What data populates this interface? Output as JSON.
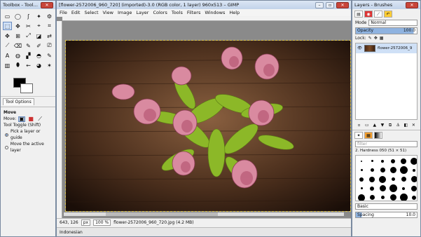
{
  "toolbox": {
    "title": "Toolbox - Tool Options",
    "tools": [
      "▭",
      "◯",
      "ʃ",
      "✦",
      "⚙",
      "⬚",
      "✥",
      "✂",
      "⌖",
      "⌗",
      "✥",
      "⊞",
      "⤢",
      "◪",
      "⇄",
      "⟋",
      "⌫",
      "✎",
      "✐",
      "⎚",
      "A",
      "◍",
      "▞",
      "◓",
      "✎",
      "▥",
      "⬮",
      "⇜",
      "◕",
      "✶"
    ],
    "tab_label": "Tool Options",
    "options_title": "Move",
    "move_label": "Move:",
    "toggle_label": "Tool Toggle  (Shift)",
    "radio1": "Pick a layer or guide",
    "radio2": "Move the active layer"
  },
  "main": {
    "title": "[flower-2572006_960_720] (imported)-3.0 (RGB color, 1 layer) 960x513 – GIMP",
    "menu": [
      "File",
      "Edit",
      "Select",
      "View",
      "Image",
      "Layer",
      "Colors",
      "Tools",
      "Filters",
      "Windows",
      "Help"
    ],
    "status": {
      "coords": "643, 126",
      "unit": "px",
      "zoom": "100 %",
      "file_info": "flower-2572006_960_720.jpg (4.2 MB)"
    },
    "language": "Indonesian"
  },
  "layers": {
    "title": "Layers - Brushes",
    "mode_label": "Mode",
    "mode_value": "Normal",
    "opacity_label": "Opacity",
    "opacity_value": "100.0",
    "lock_label": "Lock:",
    "layer_name": "flower-2572006_9",
    "filter_placeholder": "filter",
    "brush_name": "2. Hardness 050 (51 × 51)",
    "brush_tag": "Basic",
    "spacing_label": "Spacing",
    "spacing_value": "10.0"
  }
}
